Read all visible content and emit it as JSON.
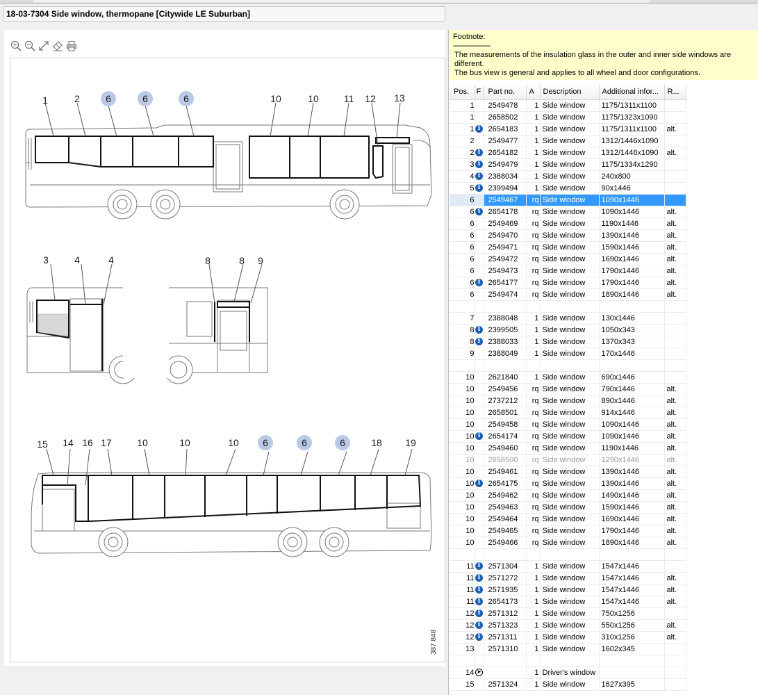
{
  "title": "18-03-7304 Side window, thermopane [Citywide LE Suburban]",
  "toolbar": {
    "icons": [
      "zoom-in-icon",
      "zoom-out-icon",
      "fit-icon",
      "eraser-icon",
      "print-icon"
    ]
  },
  "drawing": {
    "id_text": "387 848",
    "labels": [
      "1",
      "2",
      "6",
      "6",
      "6",
      "10",
      "10",
      "11",
      "12",
      "13",
      "3",
      "4",
      "4",
      "8",
      "8",
      "9",
      "15",
      "14",
      "16",
      "17",
      "10",
      "10",
      "10",
      "6",
      "6",
      "6",
      "18",
      "19"
    ],
    "highlight_color": "#b9c9e6"
  },
  "footnote": {
    "heading": "Footnote:",
    "separator": "--------------------",
    "line1": "The measurements of the insulation glass in the outer and inner  side windows are different.",
    "line2": "The bus view is general and applies to all wheel and door  configurations."
  },
  "table": {
    "headers": [
      "Pos.",
      "F",
      "Part no.",
      "A",
      "Description",
      "Additional infor...",
      "R..."
    ],
    "rows": [
      {
        "pos": "1",
        "flag": "",
        "pn": "2549478",
        "a": "1",
        "desc": "Side window",
        "add": "1175/1311x1100",
        "r": ""
      },
      {
        "pos": "1",
        "flag": "",
        "pn": "2658502",
        "a": "1",
        "desc": "Side window",
        "add": "1175/1323x1090",
        "r": ""
      },
      {
        "pos": "1",
        "flag": "i",
        "pn": "2654183",
        "a": "1",
        "desc": "Side window",
        "add": "1175/1311x1100",
        "r": "alt."
      },
      {
        "pos": "2",
        "flag": "",
        "pn": "2549477",
        "a": "1",
        "desc": "Side window",
        "add": "1312/1446x1090",
        "r": ""
      },
      {
        "pos": "2",
        "flag": "i",
        "pn": "2654182",
        "a": "1",
        "desc": "Side window",
        "add": "1312/1446x1090",
        "r": "alt."
      },
      {
        "pos": "3",
        "flag": "i",
        "pn": "2549479",
        "a": "1",
        "desc": "Side window",
        "add": "1175/1334x1290",
        "r": ""
      },
      {
        "pos": "4",
        "flag": "i",
        "pn": "2388034",
        "a": "1",
        "desc": "Side window",
        "add": "240x800",
        "r": ""
      },
      {
        "pos": "5",
        "flag": "i",
        "pn": "2399494",
        "a": "1",
        "desc": "Side window",
        "add": "90x1446",
        "r": ""
      },
      {
        "pos": "6",
        "flag": "",
        "pn": "2549467",
        "a": "rq",
        "desc": "Side window",
        "add": "1090x1446",
        "r": "",
        "selected": true
      },
      {
        "pos": "6",
        "flag": "i",
        "pn": "2654178",
        "a": "rq",
        "desc": "Side window",
        "add": "1090x1446",
        "r": "alt."
      },
      {
        "pos": "6",
        "flag": "",
        "pn": "2549469",
        "a": "rq",
        "desc": "Side window",
        "add": "1190x1446",
        "r": "alt."
      },
      {
        "pos": "6",
        "flag": "",
        "pn": "2549470",
        "a": "rq",
        "desc": "Side window",
        "add": "1390x1446",
        "r": "alt."
      },
      {
        "pos": "6",
        "flag": "",
        "pn": "2549471",
        "a": "rq",
        "desc": "Side window",
        "add": "1590x1446",
        "r": "alt."
      },
      {
        "pos": "6",
        "flag": "",
        "pn": "2549472",
        "a": "rq",
        "desc": "Side window",
        "add": "1690x1446",
        "r": "alt."
      },
      {
        "pos": "6",
        "flag": "",
        "pn": "2549473",
        "a": "rq",
        "desc": "Side window",
        "add": "1790x1446",
        "r": "alt."
      },
      {
        "pos": "6",
        "flag": "i",
        "pn": "2654177",
        "a": "rq",
        "desc": "Side window",
        "add": "1790x1446",
        "r": "alt."
      },
      {
        "pos": "6",
        "flag": "",
        "pn": "2549474",
        "a": "rq",
        "desc": "Side window",
        "add": "1890x1446",
        "r": "alt."
      },
      {
        "blank": true
      },
      {
        "pos": "7",
        "flag": "",
        "pn": "2388048",
        "a": "1",
        "desc": "Side window",
        "add": "130x1446",
        "r": ""
      },
      {
        "pos": "8",
        "flag": "i",
        "pn": "2399505",
        "a": "1",
        "desc": "Side window",
        "add": "1050x343",
        "r": ""
      },
      {
        "pos": "8",
        "flag": "i",
        "pn": "2388033",
        "a": "1",
        "desc": "Side window",
        "add": "1370x343",
        "r": ""
      },
      {
        "pos": "9",
        "flag": "",
        "pn": "2388049",
        "a": "1",
        "desc": "Side window",
        "add": "170x1446",
        "r": ""
      },
      {
        "blank": true
      },
      {
        "pos": "10",
        "flag": "",
        "pn": "2621840",
        "a": "1",
        "desc": "Side window",
        "add": "690x1446",
        "r": ""
      },
      {
        "pos": "10",
        "flag": "",
        "pn": "2549456",
        "a": "rq",
        "desc": "Side window",
        "add": "790x1446",
        "r": "alt."
      },
      {
        "pos": "10",
        "flag": "",
        "pn": "2737212",
        "a": "rq",
        "desc": "Side window",
        "add": "890x1446",
        "r": "alt."
      },
      {
        "pos": "10",
        "flag": "",
        "pn": "2658501",
        "a": "rq",
        "desc": "Side window",
        "add": "914x1446",
        "r": "alt."
      },
      {
        "pos": "10",
        "flag": "",
        "pn": "2549458",
        "a": "rq",
        "desc": "Side window",
        "add": "1090x1446",
        "r": "alt."
      },
      {
        "pos": "10",
        "flag": "i",
        "pn": "2654174",
        "a": "rq",
        "desc": "Side window",
        "add": "1090x1446",
        "r": "alt."
      },
      {
        "pos": "10",
        "flag": "",
        "pn": "2549460",
        "a": "rq",
        "desc": "Side window",
        "add": "1190x1446",
        "r": "alt."
      },
      {
        "pos": "10",
        "flag": "",
        "pn": "2658500",
        "a": "rq",
        "desc": "Side window",
        "add": "1290x1446",
        "r": "alt.",
        "dim": true
      },
      {
        "pos": "10",
        "flag": "",
        "pn": "2549461",
        "a": "rq",
        "desc": "Side window",
        "add": "1390x1446",
        "r": "alt."
      },
      {
        "pos": "10",
        "flag": "i",
        "pn": "2654175",
        "a": "rq",
        "desc": "Side window",
        "add": "1390x1446",
        "r": "alt."
      },
      {
        "pos": "10",
        "flag": "",
        "pn": "2549462",
        "a": "rq",
        "desc": "Side window",
        "add": "1490x1446",
        "r": "alt."
      },
      {
        "pos": "10",
        "flag": "",
        "pn": "2549463",
        "a": "rq",
        "desc": "Side window",
        "add": "1590x1446",
        "r": "alt."
      },
      {
        "pos": "10",
        "flag": "",
        "pn": "2549464",
        "a": "rq",
        "desc": "Side window",
        "add": "1690x1446",
        "r": "alt."
      },
      {
        "pos": "10",
        "flag": "",
        "pn": "2549465",
        "a": "rq",
        "desc": "Side window",
        "add": "1790x1446",
        "r": "alt."
      },
      {
        "pos": "10",
        "flag": "",
        "pn": "2549466",
        "a": "rq",
        "desc": "Side window",
        "add": "1890x1446",
        "r": "alt."
      },
      {
        "blank": true
      },
      {
        "pos": "11",
        "flag": "i",
        "pn": "2571304",
        "a": "1",
        "desc": "Side window",
        "add": "1547x1446",
        "r": ""
      },
      {
        "pos": "11",
        "flag": "i",
        "pn": "2571272",
        "a": "1",
        "desc": "Side window",
        "add": "1547x1446",
        "r": "alt."
      },
      {
        "pos": "11",
        "flag": "i",
        "pn": "2571935",
        "a": "1",
        "desc": "Side window",
        "add": "1547x1446",
        "r": "alt."
      },
      {
        "pos": "11",
        "flag": "i",
        "pn": "2654173",
        "a": "1",
        "desc": "Side window",
        "add": "1547x1446",
        "r": "alt."
      },
      {
        "pos": "12",
        "flag": "i",
        "pn": "2571312",
        "a": "1",
        "desc": "Side window",
        "add": "750x1256",
        "r": ""
      },
      {
        "pos": "12",
        "flag": "i",
        "pn": "2571323",
        "a": "1",
        "desc": "Side window",
        "add": "550x1256",
        "r": "alt."
      },
      {
        "pos": "12",
        "flag": "i",
        "pn": "2571311",
        "a": "1",
        "desc": "Side window",
        "add": "310x1256",
        "r": "alt."
      },
      {
        "pos": "13",
        "flag": "",
        "pn": "2571310",
        "a": "1",
        "desc": "Side window",
        "add": "1602x345",
        "r": ""
      },
      {
        "blank": true
      },
      {
        "pos": "14",
        "flag": "arrow",
        "pn": "",
        "a": "1",
        "desc": "Driver's window",
        "add": "",
        "r": ""
      },
      {
        "pos": "15",
        "flag": "",
        "pn": "2571324",
        "a": "1",
        "desc": "Side window",
        "add": "1627x395",
        "r": ""
      }
    ]
  }
}
